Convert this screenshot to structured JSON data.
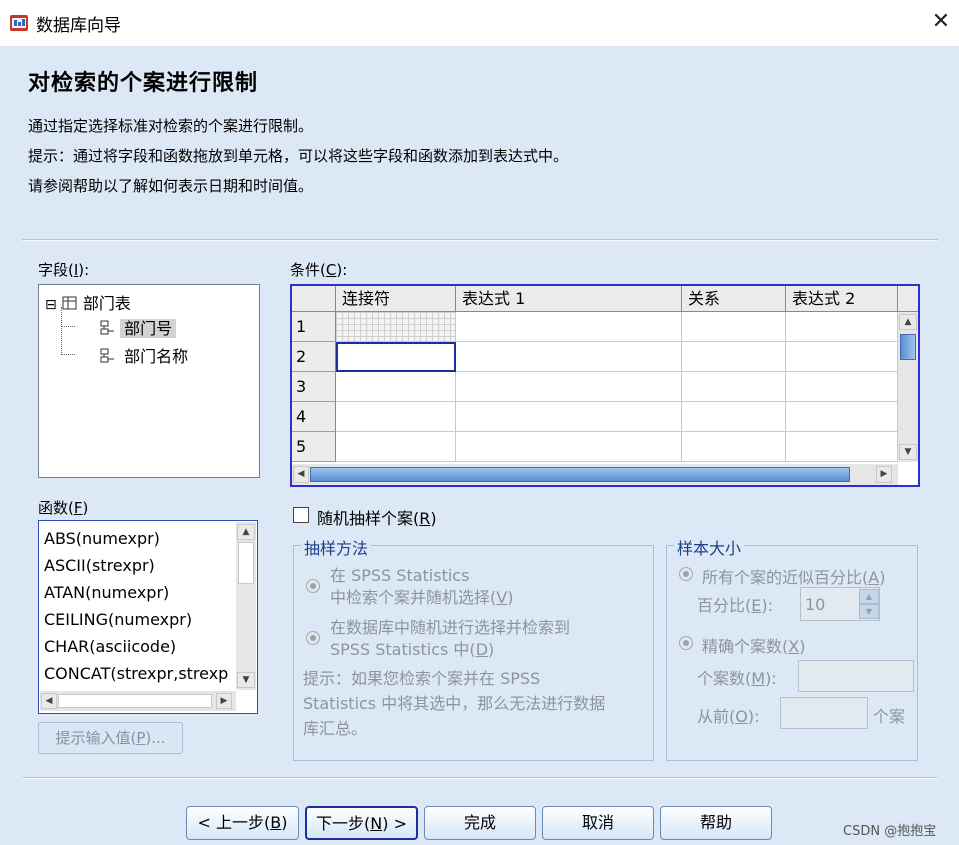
{
  "window": {
    "title": "数据库向导",
    "close_glyph": "✕"
  },
  "heading": "对检索的个案进行限制",
  "description": [
    "通过指定选择标准对检索的个案进行限制。",
    "提示：通过将字段和函数拖放到单元格，可以将这些字段和函数添加到表达式中。",
    "请参阅帮助以了解如何表示日期和时间值。"
  ],
  "fields": {
    "label_pre": "字段(",
    "label_key": "I",
    "label_post": "):",
    "tree": [
      {
        "label": "部门表",
        "expander": "⊟"
      },
      {
        "label": "部门号",
        "selected": true
      },
      {
        "label": "部门名称"
      }
    ]
  },
  "conditions": {
    "label_pre": "条件(",
    "label_key": "C",
    "label_post": "):",
    "columns": [
      "连接符",
      "表达式 1",
      "关系",
      "表达式 2"
    ],
    "rows": [
      "1",
      "2",
      "3",
      "4",
      "5"
    ]
  },
  "functions": {
    "label_pre": "函数(",
    "label_key": "F",
    "label_post": ")",
    "items": [
      "ABS(numexpr)",
      "ASCII(strexpr)",
      "ATAN(numexpr)",
      "CEILING(numexpr)",
      "CHAR(asciicode)",
      "CONCAT(strexpr,strexp"
    ]
  },
  "prompt_button": {
    "pre": "提示输入值(",
    "key": "P",
    "post": ")..."
  },
  "random_sample": {
    "pre": "随机抽样个案(",
    "key": "R",
    "post": ")",
    "checked": false
  },
  "sampling_method": {
    "legend": "抽样方法",
    "opt1_line1": "在 SPSS Statistics",
    "opt1_line2_pre": "中检索个案并随机选择(",
    "opt1_line2_key": "V",
    "opt1_line2_post": ")",
    "opt2_line1": "在数据库中随机进行选择并检索到",
    "opt2_line2_pre": "SPSS Statistics 中(",
    "opt2_line2_key": "D",
    "opt2_line2_post": ")",
    "hint_lines": [
      "提示：如果您检索个案并在 SPSS",
      "Statistics 中将其选中，那么无法进行数据",
      "库汇总。"
    ]
  },
  "sample_size": {
    "legend": "样本大小",
    "approx_pre": "所有个案的近似百分比(",
    "approx_key": "A",
    "approx_post": ")",
    "percent_pre": "百分比(",
    "percent_key": "E",
    "percent_post": "):",
    "percent_value": "10",
    "exact_pre": "精确个案数(",
    "exact_key": "X",
    "exact_post": ")",
    "count_pre": "个案数(",
    "count_key": "M",
    "count_post": "):",
    "from_pre": "从前(",
    "from_key": "O",
    "from_post": "):",
    "cases_suffix": "个案"
  },
  "buttons": {
    "back": {
      "pre": "< 上一步(",
      "key": "B",
      "post": ")"
    },
    "next": {
      "pre": "下一步(",
      "key": "N",
      "post": ") >"
    },
    "finish": "完成",
    "cancel": "取消",
    "help": "帮助"
  },
  "watermark": "CSDN @抱抱宝"
}
